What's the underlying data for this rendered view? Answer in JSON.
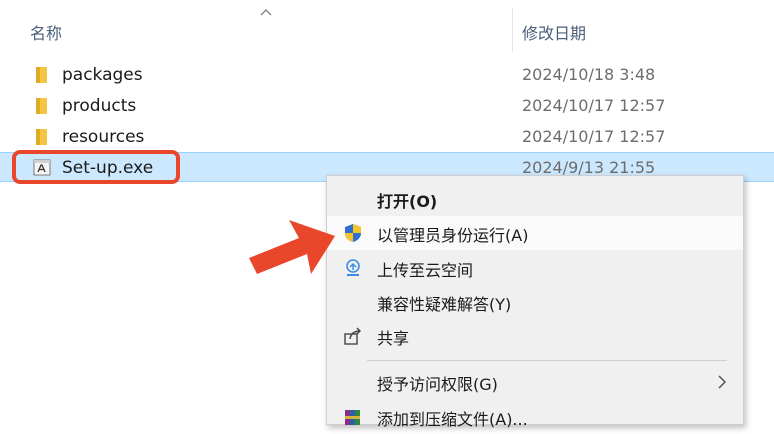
{
  "header": {
    "name_col": "名称",
    "date_col": "修改日期"
  },
  "files": [
    {
      "name": "packages",
      "date": "2024/10/18 3:48",
      "icon": "folder-icon"
    },
    {
      "name": "products",
      "date": "2024/10/17 12:57",
      "icon": "folder-icon"
    },
    {
      "name": "resources",
      "date": "2024/10/17 12:57",
      "icon": "folder-icon"
    },
    {
      "name": "Set-up.exe",
      "date": "2024/9/13 21:55",
      "icon": "exe-icon"
    }
  ],
  "context_menu": {
    "items": [
      {
        "label": "打开(O)",
        "bold": true
      },
      {
        "label": "以管理员身份运行(A)",
        "icon": "uac-shield-icon"
      },
      {
        "label": "上传至云空间",
        "icon": "cloud-upload-icon"
      },
      {
        "label": "兼容性疑难解答(Y)"
      },
      {
        "label": "共享",
        "icon": "share-icon"
      },
      {
        "label": "授予访问权限(G)",
        "submenu": true
      },
      {
        "label": "添加到压缩文件(A)...",
        "icon": "winrar-icon"
      }
    ]
  },
  "colors": {
    "selection": "#cce8ff",
    "annotation": "#e8472b",
    "folder": "#f4c542"
  }
}
